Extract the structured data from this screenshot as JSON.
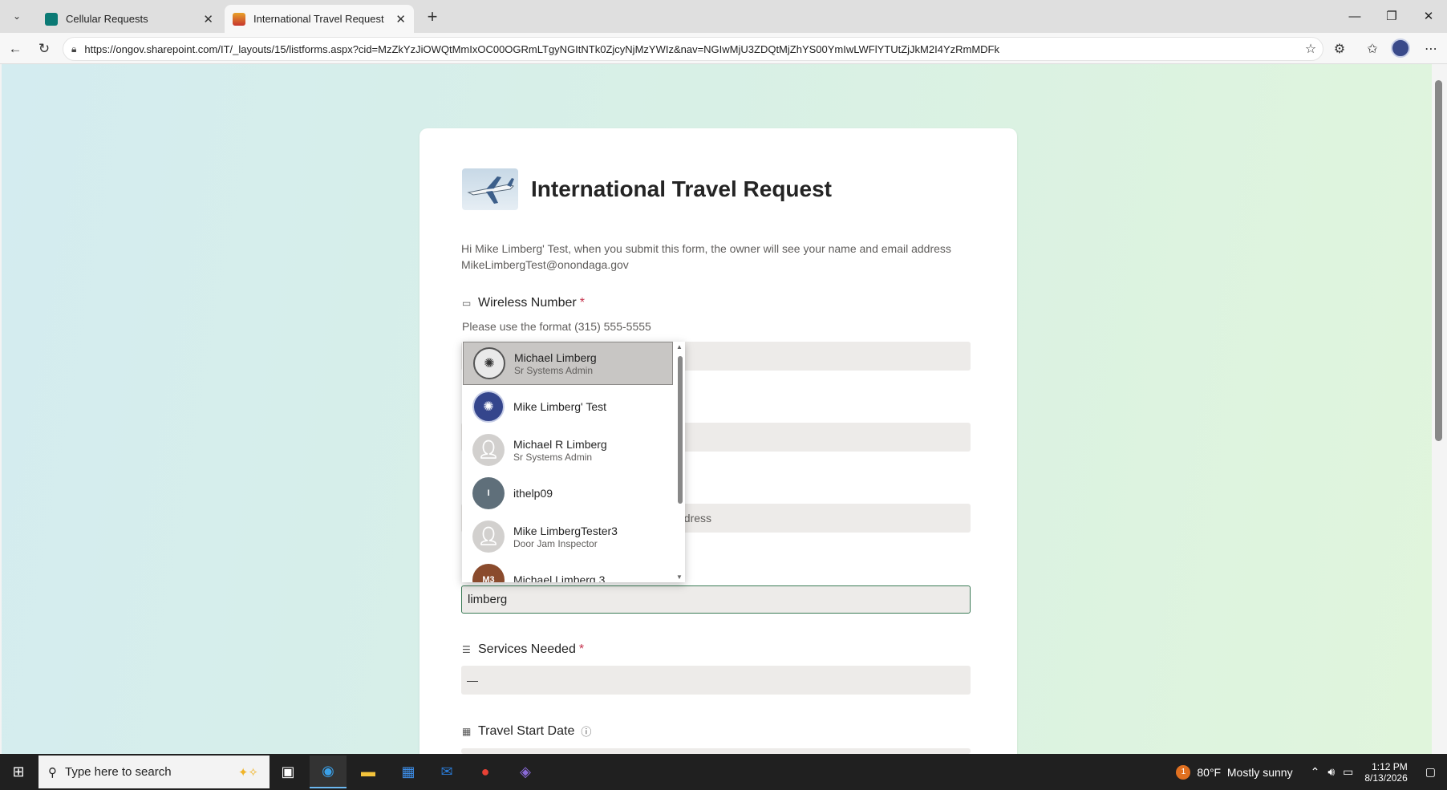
{
  "browser": {
    "tabs": [
      {
        "label": "Cellular Requests",
        "active": false
      },
      {
        "label": "International Travel Request",
        "active": true
      }
    ],
    "url": "https://ongov.sharepoint.com/IT/_layouts/15/listforms.aspx?cid=MzZkYzJiOWQtMmIxOC00OGRmLTgyNGItNTk0ZjcyNjMzYWIz&nav=NGIwMjU3ZDQtMjZhYS00YmIwLWFlYTUtZjJkM2I4YzRmMDFk"
  },
  "form": {
    "title": "International Travel Request",
    "intro": "Hi Mike Limberg' Test, when you submit this form, the owner will see your name and email address MikeLimbergTest@onondaga.gov",
    "questions": [
      {
        "label": "Wireless Number",
        "required": "*",
        "hint": "Please use the format (315) 555-5555",
        "value": ""
      },
      {
        "label": "",
        "value": ""
      },
      {
        "label": "",
        "placeholder_fragment": "ddress"
      },
      {
        "label": "",
        "value": "limberg"
      },
      {
        "label": "Services Needed",
        "required": "*",
        "value": "—"
      },
      {
        "label": "Travel Start Date",
        "info_icon": "info-icon"
      }
    ]
  },
  "people_picker": {
    "results": [
      {
        "name": "Michael Limberg",
        "title": "Sr Systems Admin",
        "avatar": "seal",
        "selected": true
      },
      {
        "name": "Mike Limberg' Test",
        "title": "",
        "avatar": "seal-blue",
        "selected": false
      },
      {
        "name": "Michael R Limberg",
        "title": "Sr Systems Admin",
        "avatar": "person-placeholder",
        "selected": false
      },
      {
        "name": "ithelp09",
        "title": "",
        "avatar": "initials",
        "initials": "I",
        "avatar_color": "#5f6f7a",
        "selected": false
      },
      {
        "name": "Mike LimbergTester3",
        "title": "Door Jam Inspector",
        "avatar": "person-placeholder",
        "selected": false
      },
      {
        "name": "Michael Limberg 3",
        "title": "",
        "avatar": "initials",
        "initials": "M3",
        "avatar_color": "#8a4b2d",
        "selected": false
      }
    ]
  },
  "taskbar": {
    "search_placeholder": "Type here to search",
    "weather": "80°F  Mostly sunny",
    "weather_badge": "1",
    "time": "1:12 PM",
    "date": "8/13/2026"
  },
  "colors": {
    "accent_green": "#3a7a55",
    "required_red": "#c4314b"
  }
}
